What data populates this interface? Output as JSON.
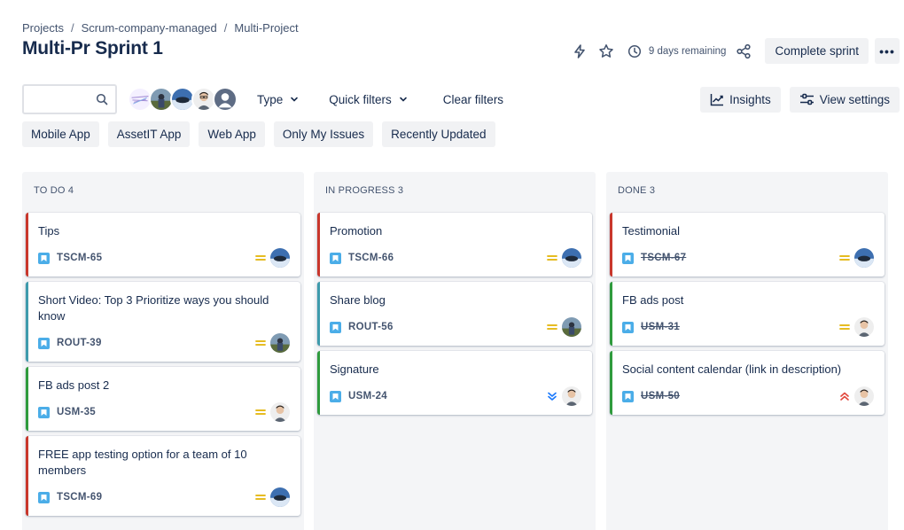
{
  "breadcrumb": {
    "items": [
      "Projects",
      "Scrum-company-managed",
      "Multi-Project"
    ],
    "separator": "/"
  },
  "page_title": "Multi-Pr Sprint 1",
  "header": {
    "icons": [
      "lightning-icon",
      "star-icon",
      "clock-icon",
      "share-icon"
    ],
    "remaining": "9 days remaining",
    "complete_label": "Complete sprint",
    "more_label": "•••"
  },
  "filters": {
    "search_placeholder": "",
    "type_label": "Type",
    "quick_filters_label": "Quick filters",
    "clear_label": "Clear filters",
    "insights_label": "Insights",
    "view_settings_label": "View settings"
  },
  "quick_filters": [
    "Mobile App",
    "AssetIT App",
    "Web App",
    "Only My Issues",
    "Recently Updated"
  ],
  "colors": {
    "accent_story": "#4bade8",
    "medium_priority": "#e2b203",
    "low_priority": "#1d7afc",
    "high_priority": "#e2483d"
  },
  "columns": [
    {
      "title": "TO DO 4",
      "cards": [
        {
          "title": "Tips",
          "key": "TSCM-65",
          "priority": "medium",
          "done": false
        },
        {
          "title": "Short Video: Top 3 Prioritize ways you should know",
          "key": "ROUT-39",
          "priority": "medium",
          "done": false
        },
        {
          "title": "FB ads post 2",
          "key": "USM-35",
          "priority": "medium",
          "done": false
        },
        {
          "title": "FREE app testing option for a team of 10 members",
          "key": "TSCM-69",
          "priority": "medium",
          "done": false
        }
      ]
    },
    {
      "title": "IN PROGRESS 3",
      "cards": [
        {
          "title": "Promotion",
          "key": "TSCM-66",
          "priority": "medium",
          "done": false
        },
        {
          "title": "Share blog",
          "key": "ROUT-56",
          "priority": "medium",
          "done": false
        },
        {
          "title": "Signature",
          "key": "USM-24",
          "priority": "low",
          "done": false
        }
      ]
    },
    {
      "title": "DONE 3",
      "cards": [
        {
          "title": "Testimonial",
          "key": "TSCM-67",
          "priority": "medium",
          "done": true
        },
        {
          "title": "FB ads post",
          "key": "USM-31",
          "priority": "medium",
          "done": true
        },
        {
          "title": "Social content calendar (link in description)",
          "key": "USM-50",
          "priority": "high",
          "done": true
        }
      ]
    }
  ]
}
